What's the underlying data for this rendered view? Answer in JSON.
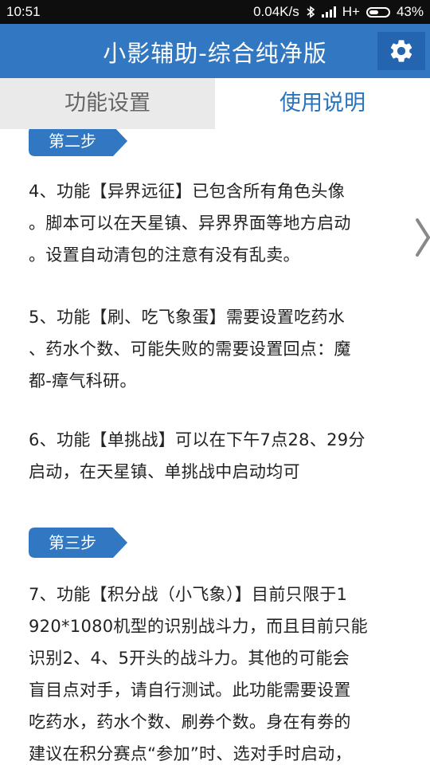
{
  "status": {
    "time": "10:51",
    "speed": "0.04K/s",
    "network": "H+",
    "battery": "43%"
  },
  "appbar": {
    "title": "小影辅助-综合纯净版"
  },
  "tabs": [
    {
      "label": "功能设置",
      "active": false
    },
    {
      "label": "使用说明",
      "active": true
    }
  ],
  "colors": {
    "primary": "#3277c2",
    "tab_active": "#2a74bd"
  },
  "icons": {
    "settings": "gear-icon",
    "bluetooth": "bluetooth-icon",
    "signal": "signal-icon",
    "battery": "battery-icon"
  },
  "content": {
    "step2": "第二步",
    "p4": [
      "4、功能【异界远征】已包含所有角色头像",
      "。脚本可以在天星镇、异界界面等地方启动",
      "。设置自动清包的注意有没有乱卖。"
    ],
    "p5": [
      "5、功能【刷、吃飞象蛋】需要设置吃药水",
      "、药水个数、可能失败的需要设置回点：魔",
      "都-瘴气科研。"
    ],
    "p6": [
      "6、功能【单挑战】可以在下午7点28、29分",
      "启动，在天星镇、单挑战中启动均可"
    ],
    "step3": "第三步",
    "p7": [
      "7、功能【积分战（小飞象）】目前只限于1",
      "920*1080机型的识别战斗力，而且目前只能",
      "识别2、4、5开头的战斗力。其他的可能会",
      "盲目点对手，请自行测试。此功能需要设置",
      "吃药水，药水个数、刷券个数。身在有劵的",
      "建议在积分赛点“参加”时、选对手时启动，"
    ]
  }
}
